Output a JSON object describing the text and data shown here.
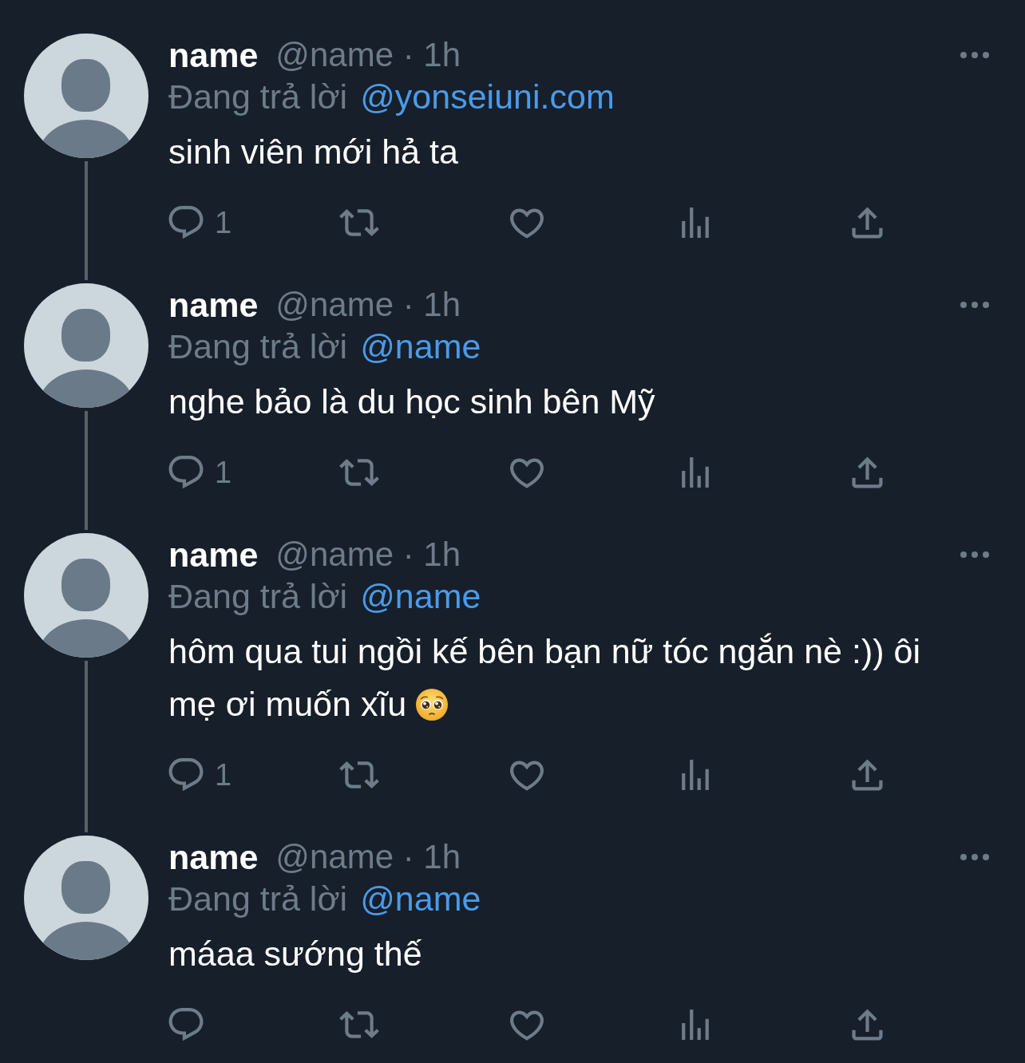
{
  "tweets": [
    {
      "display_name": "name",
      "handle_and_time": "@name · 1h",
      "reply_prefix": "Đang trả lời",
      "mention": "@yonseiuni.com",
      "text": "sinh viên mới hả ta",
      "emoji": false,
      "thread_line": true,
      "actions": [
        {
          "kind": "reply",
          "count": "1"
        },
        {
          "kind": "repost"
        },
        {
          "kind": "like"
        },
        {
          "kind": "views"
        },
        {
          "kind": "share"
        }
      ]
    },
    {
      "display_name": "name",
      "handle_and_time": "@name · 1h",
      "reply_prefix": "Đang trả lời",
      "mention": "@name",
      "text": "nghe bảo là du học sinh bên Mỹ",
      "emoji": false,
      "thread_line": true,
      "actions": [
        {
          "kind": "reply",
          "count": "1"
        },
        {
          "kind": "repost"
        },
        {
          "kind": "like"
        },
        {
          "kind": "views"
        },
        {
          "kind": "share"
        }
      ]
    },
    {
      "display_name": "name",
      "handle_and_time": "@name · 1h",
      "reply_prefix": "Đang trả lời",
      "mention": "@name",
      "text": "hôm qua tui ngồi kế bên bạn nữ tóc ngắn nè :)) ôi mẹ ơi muốn xĩu",
      "emoji": true,
      "thread_line": true,
      "actions": [
        {
          "kind": "reply",
          "count": "1"
        },
        {
          "kind": "repost"
        },
        {
          "kind": "like"
        },
        {
          "kind": "views"
        },
        {
          "kind": "share"
        }
      ]
    },
    {
      "display_name": "name",
      "handle_and_time": "@name · 1h",
      "reply_prefix": "Đang trả lời",
      "mention": "@name",
      "text": "máaa sướng thế",
      "emoji": false,
      "thread_line": false,
      "actions": [
        {
          "kind": "reply"
        },
        {
          "kind": "repost"
        },
        {
          "kind": "like"
        },
        {
          "kind": "views"
        },
        {
          "kind": "share"
        }
      ]
    }
  ]
}
